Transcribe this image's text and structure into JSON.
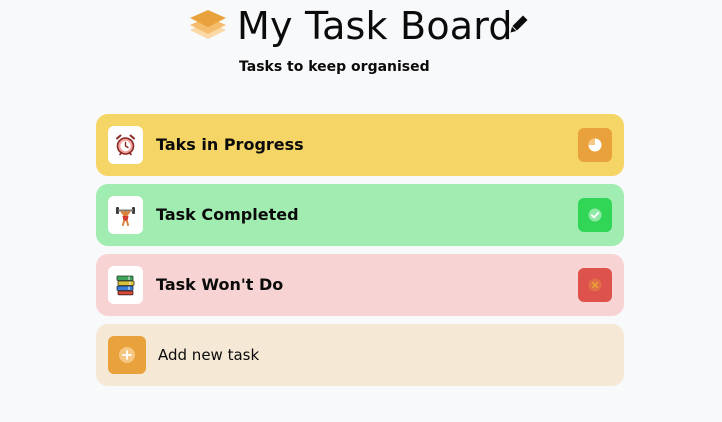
{
  "header": {
    "title": "My Task Board",
    "subtitle": "Tasks to keep organised",
    "logo_icon": "stack-layers-icon",
    "edit_icon": "pencil-icon"
  },
  "tasks": [
    {
      "label": "Taks in Progress",
      "icon": "alarm-clock-icon",
      "status": "in-progress",
      "status_icon": "time-icon",
      "bg_color": "#f5d565",
      "status_color": "#e9a23b"
    },
    {
      "label": "Task Completed",
      "icon": "weightlifting-icon",
      "status": "completed",
      "status_icon": "check-icon",
      "bg_color": "#a0ecb1",
      "status_color": "#32d657"
    },
    {
      "label": "Task Won't Do",
      "icon": "books-icon",
      "status": "wont-do",
      "status_icon": "close-icon",
      "bg_color": "#f7d4d3",
      "status_color": "#dd524c"
    }
  ],
  "add_task": {
    "label": "Add new task",
    "icon": "plus-icon",
    "bg_color": "#f5e8d5",
    "icon_color": "#e9a23b"
  }
}
